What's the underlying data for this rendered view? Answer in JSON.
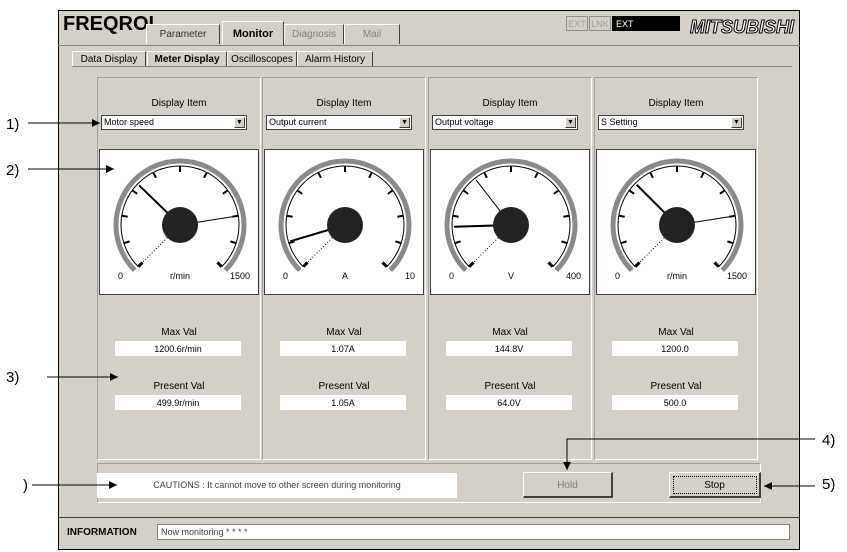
{
  "app": {
    "brand": "FREQROL",
    "manufacturer": "MITSUBISHI",
    "indicators": [
      "EXT",
      "LNK",
      "EXT"
    ],
    "main_tabs": [
      "Parameter",
      "Monitor",
      "Diagnosis",
      "Mail"
    ],
    "active_main_tab": "Monitor",
    "sub_tabs": [
      "Data Display",
      "Meter Display",
      "Oscilloscopes",
      "Alarm History"
    ],
    "active_sub_tab": "Meter Display"
  },
  "meters": [
    {
      "display_item_label": "Display Item",
      "selected": "Motor speed",
      "min": "0",
      "unit": "r/min",
      "max": "1500",
      "max_label": "Max Val",
      "max_value": "1200.6r/min",
      "present_label": "Present Val",
      "present_value": "499.9r/min",
      "max_fraction": 0.8,
      "present_fraction": 0.33
    },
    {
      "display_item_label": "Display Item",
      "selected": "Output current",
      "min": "0",
      "unit": "A",
      "max": "10",
      "max_label": "Max Val",
      "max_value": "1.07A",
      "present_label": "Present Val",
      "present_value": "1.05A",
      "max_fraction": 0.107,
      "present_fraction": 0.105
    },
    {
      "display_item_label": "Display Item",
      "selected": "Output voltage",
      "min": "0",
      "unit": "V",
      "max": "400",
      "max_label": "Max Val",
      "max_value": "144.8V",
      "present_label": "Present Val",
      "present_value": "64.0V",
      "max_fraction": 0.36,
      "present_fraction": 0.16
    },
    {
      "display_item_label": "Display Item",
      "selected": "S Setting",
      "min": "0",
      "unit": "r/min",
      "max": "1500",
      "max_label": "Max Val",
      "max_value": "1200.0",
      "present_label": "Present Val",
      "present_value": "500.0",
      "max_fraction": 0.8,
      "present_fraction": 0.333
    }
  ],
  "caution": "CAUTIONS : It cannot move to other screen during monitoring",
  "buttons": {
    "hold": "Hold",
    "stop": "Stop"
  },
  "information": {
    "label": "INFORMATION",
    "text": "Now monitoring * * * *"
  },
  "callouts": [
    "1)",
    "2)",
    "3)",
    ")",
    "4)",
    "5)"
  ]
}
